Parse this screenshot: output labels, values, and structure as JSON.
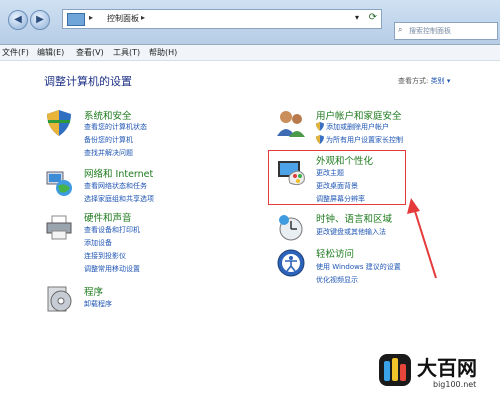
{
  "address_bar": {
    "crumb": "控制面板",
    "search_placeholder": "搜索控制面板"
  },
  "menu": [
    "文件(F)",
    "编辑(E)",
    "查看(V)",
    "工具(T)",
    "帮助(H)"
  ],
  "heading": "调整计算机的设置",
  "view_by": {
    "label": "查看方式:",
    "value": "类别"
  },
  "categories": [
    {
      "id": "system",
      "title": "系统和安全",
      "links": [
        "查看您的计算机状态",
        "备份您的计算机",
        "查找并解决问题"
      ],
      "icon": "shield-icon"
    },
    {
      "id": "network",
      "title": "网络和 Internet",
      "links": [
        "查看网络状态和任务",
        "选择家庭组和共享选项"
      ],
      "icon": "network-globe-icon"
    },
    {
      "id": "hardware",
      "title": "硬件和声音",
      "links": [
        "查看设备和打印机",
        "添加设备",
        "连接到投影仪",
        "调整常用移动设置"
      ],
      "icon": "printer-icon"
    },
    {
      "id": "programs",
      "title": "程序",
      "links": [
        "卸载程序"
      ],
      "icon": "programs-disc-icon"
    },
    {
      "id": "users",
      "title": "用户帐户和家庭安全",
      "links": [
        "添加或删除用户帐户",
        "为所有用户设置家长控制"
      ],
      "icon": "users-icon"
    },
    {
      "id": "appearance",
      "title": "外观和个性化",
      "links": [
        "更改主题",
        "更改桌面背景",
        "调整屏幕分辨率"
      ],
      "icon": "monitor-palette-icon"
    },
    {
      "id": "clock",
      "title": "时钟、语言和区域",
      "links": [
        "更改键盘或其他输入法"
      ],
      "icon": "clock-globe-icon"
    },
    {
      "id": "access",
      "title": "轻松访问",
      "links": [
        "使用 Windows 建议的设置",
        "优化视频显示"
      ],
      "icon": "ease-of-access-icon"
    }
  ],
  "watermark": {
    "title": "大百网",
    "url": "big100.net"
  }
}
